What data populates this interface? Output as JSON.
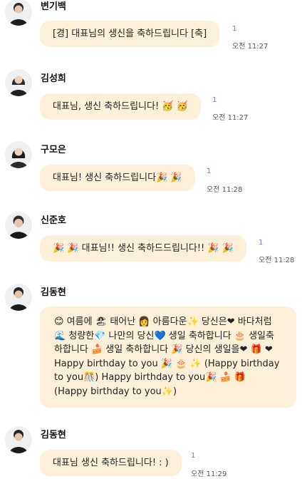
{
  "messages": [
    {
      "sender": "변기백",
      "text": "[경] 대표님의 생신을 축하드립니다 [축]",
      "unread": "1",
      "time": "오전 11:27"
    },
    {
      "sender": "김성희",
      "text": "대표님, 생신 축하드립니다! 🥳 🥳",
      "unread": "1",
      "time": "오전 11:27"
    },
    {
      "sender": "구모은",
      "text": "대표님! 생신 축하드립니다🎉 🎉",
      "unread": "1",
      "time": "오전 11:28"
    },
    {
      "sender": "신준호",
      "text": "🎉 🎉 대표님!! 생신 축하드드립니다!! 🎉 🎉",
      "unread": "1",
      "time": "오전 11:28"
    },
    {
      "sender": "김동현",
      "text": "😊 여름에 🏖 태어난 👩 아름다운✨ 당신은❤ 바다처럼🌊 청량한💎 나만의 당신💙 생일 축하합니다 🎂 생일축하합니다 🍰 생일 축하합니다 🎉 당신의 생일을❤ 🎁 ❤ Happy birthday to you 🎉 🎂 ✨ (Happy birthday to you🎊) Happy birthday to you🎉 🍰 🎁 (Happy birthday to you✨)",
      "unread": "",
      "time": ""
    },
    {
      "sender": "김동현",
      "text": "대표님 생신 축하드립니다! : )",
      "unread": "1",
      "time": "오전 11:29"
    }
  ]
}
